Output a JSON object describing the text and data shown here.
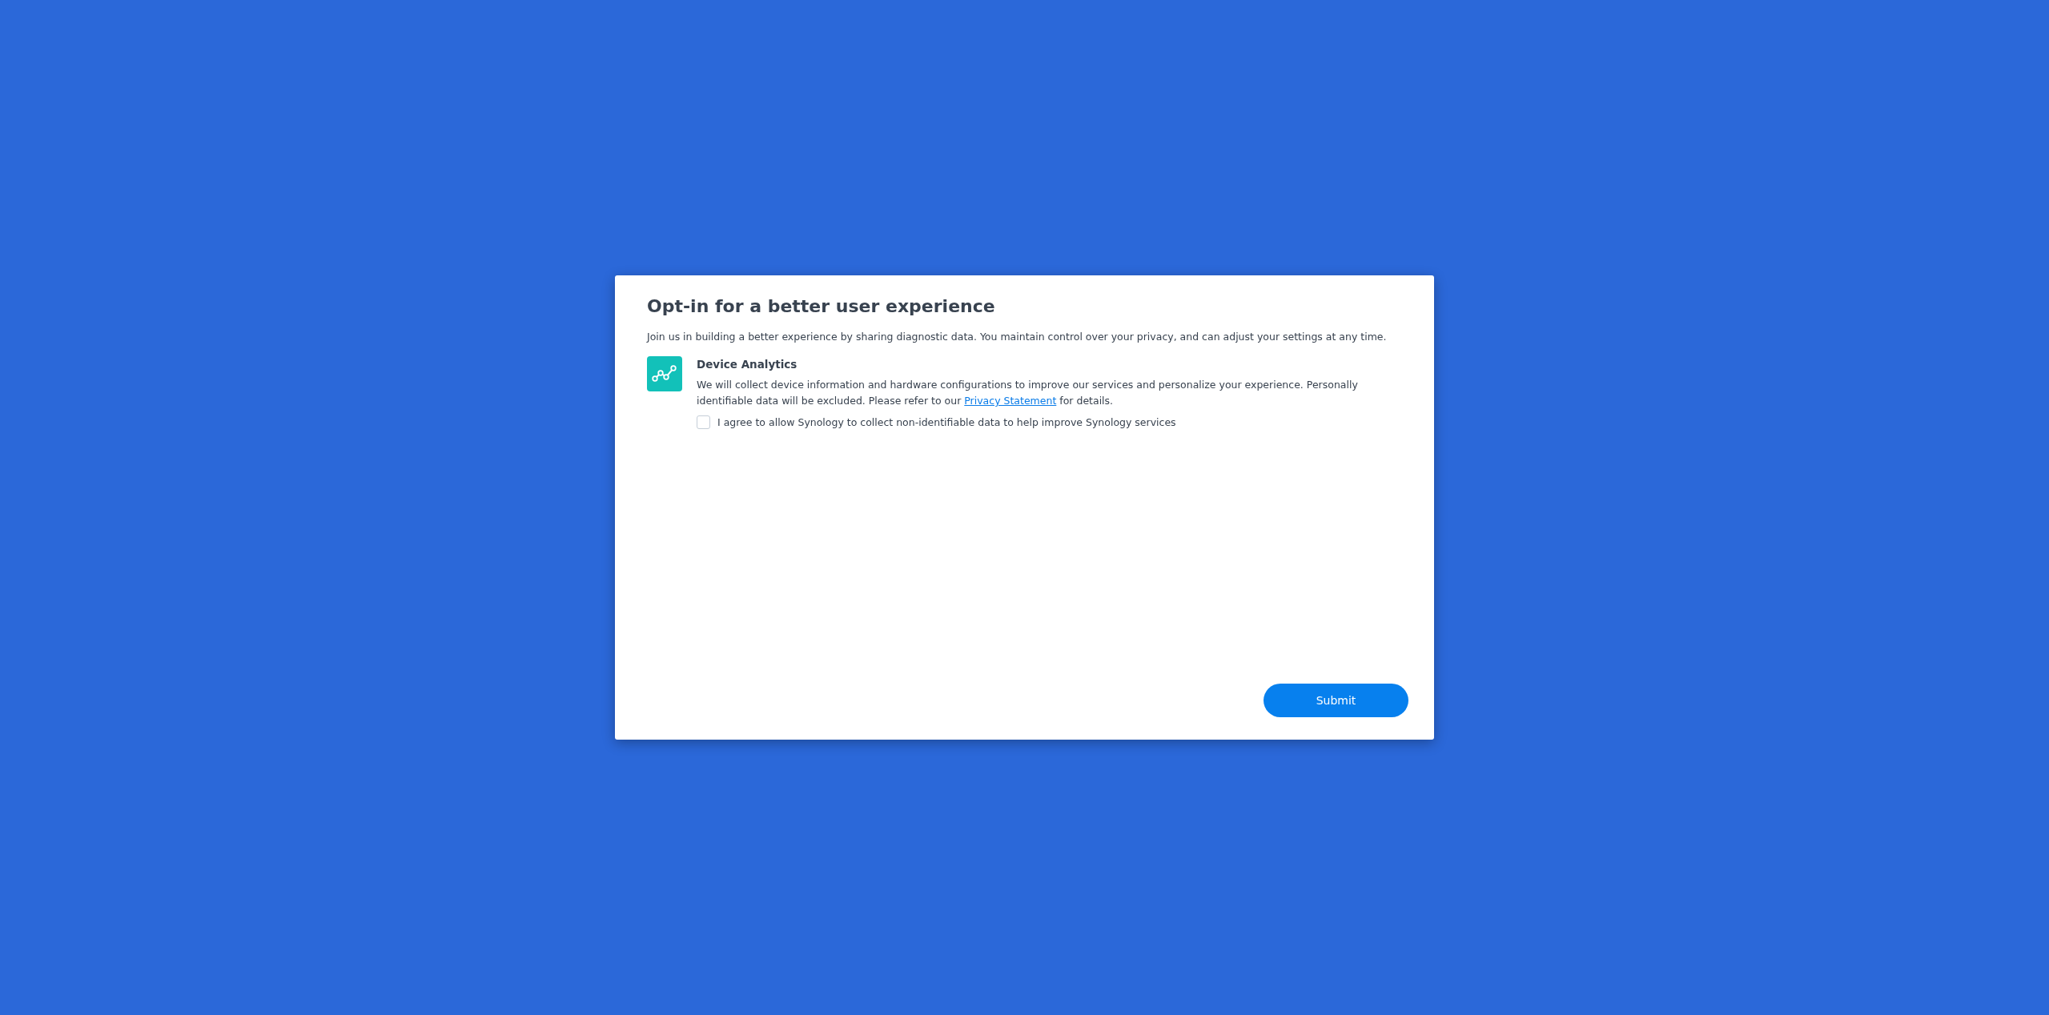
{
  "dialog": {
    "title": "Opt-in for a better user experience",
    "intro": "Join us in building a better experience by sharing diagnostic data. You maintain control over your privacy, and can adjust your settings at any time.",
    "options": [
      {
        "kind": "analytics",
        "title": "Device Analytics",
        "text_before": "We will collect device information and hardware configurations to improve our services and personalize your experience. Personally identifiable data will be excluded. Please refer to our",
        "link": "Privacy Statement",
        "text_after": "for details.",
        "consent": {
          "label": "I agree to allow Synology to collect non-identifiable data to help improve Synology services",
          "checked": false
        }
      }
    ],
    "submit": "Submit"
  }
}
